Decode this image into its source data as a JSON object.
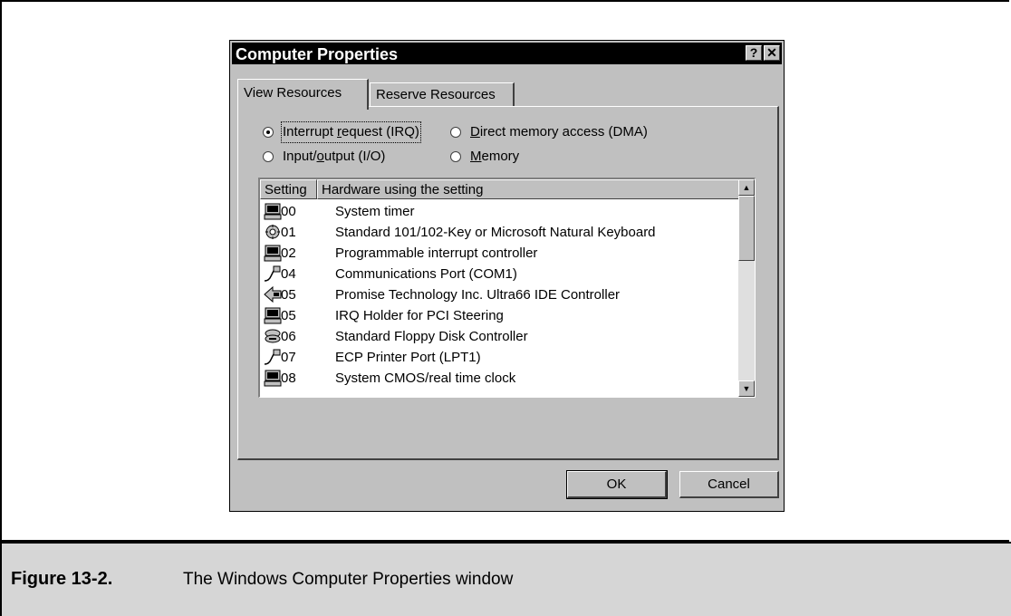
{
  "window": {
    "title": "Computer Properties",
    "help_glyph": "?",
    "close_glyph": "✕"
  },
  "tabs": [
    {
      "label": "View Resources",
      "active": true
    },
    {
      "label": "Reserve Resources",
      "active": false
    }
  ],
  "radios": {
    "irq": {
      "pre": "Interrupt ",
      "accel": "r",
      "post": "equest (IRQ)",
      "selected": true
    },
    "dma": {
      "pre": "",
      "accel": "D",
      "post": "irect memory access (DMA)",
      "selected": false
    },
    "io": {
      "pre": "Input/",
      "accel": "o",
      "post": "utput (I/O)",
      "selected": false
    },
    "mem": {
      "pre": "",
      "accel": "M",
      "post": "emory",
      "selected": false
    }
  },
  "list": {
    "columns": [
      "Setting",
      "Hardware using the setting"
    ],
    "rows": [
      {
        "icon": "computer-icon",
        "setting": "00",
        "hardware": "System timer"
      },
      {
        "icon": "keyboard-icon",
        "setting": "01",
        "hardware": "Standard 101/102-Key or Microsoft Natural Keyboard"
      },
      {
        "icon": "computer-icon",
        "setting": "02",
        "hardware": "Programmable interrupt controller"
      },
      {
        "icon": "port-icon",
        "setting": "04",
        "hardware": "Communications Port (COM1)"
      },
      {
        "icon": "ide-controller-icon",
        "setting": "05",
        "hardware": "Promise Technology Inc. Ultra66 IDE Controller"
      },
      {
        "icon": "computer-icon",
        "setting": "05",
        "hardware": "IRQ Holder for PCI Steering"
      },
      {
        "icon": "floppy-controller-icon",
        "setting": "06",
        "hardware": "Standard Floppy Disk Controller"
      },
      {
        "icon": "port-icon",
        "setting": "07",
        "hardware": "ECP Printer Port (LPT1)"
      },
      {
        "icon": "computer-icon",
        "setting": "08",
        "hardware": "System CMOS/real time clock"
      }
    ]
  },
  "buttons": {
    "ok": "OK",
    "cancel": "Cancel"
  },
  "caption": {
    "figure": "Figure 13-2.",
    "text": "The Windows Computer Properties window"
  }
}
